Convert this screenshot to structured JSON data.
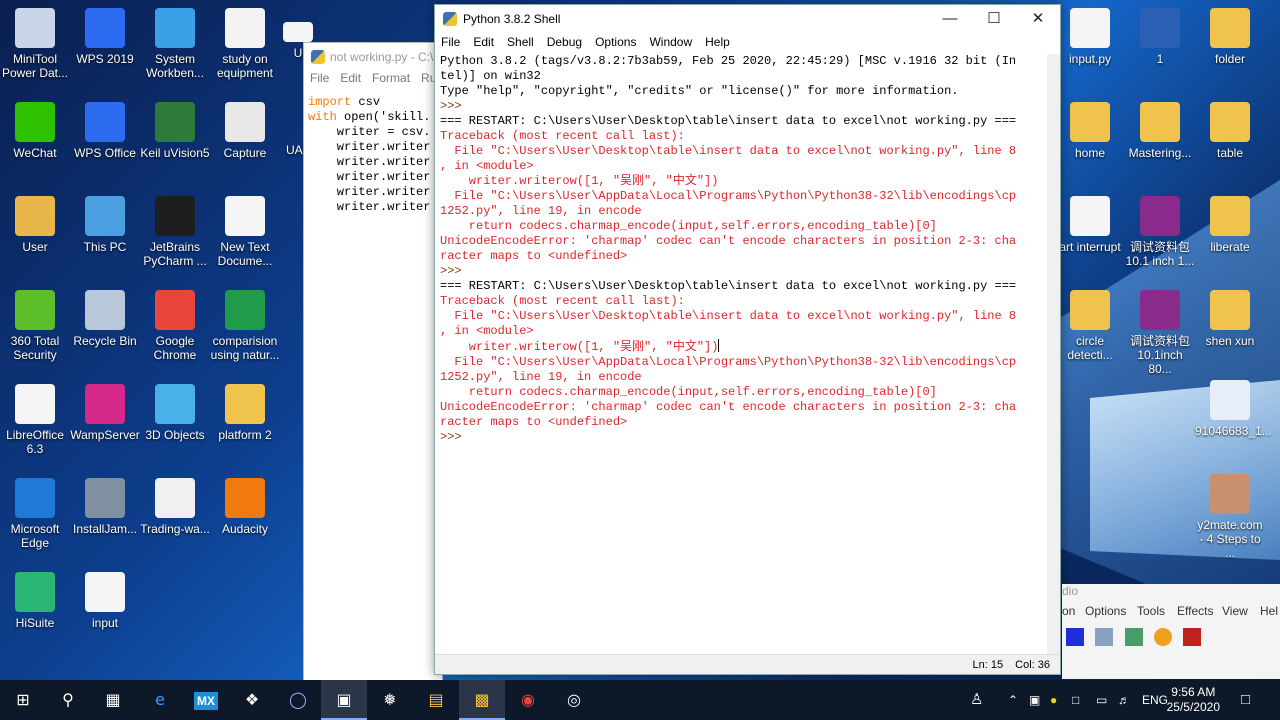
{
  "desktop_left": [
    {
      "label": "MiniTool Power Dat...",
      "icon": "minitool-icon",
      "color": "#c9d6e8"
    },
    {
      "label": "WPS 2019",
      "icon": "wps-icon",
      "color": "#2d6cf0"
    },
    {
      "label": "System Workben...",
      "icon": "bird-icon",
      "color": "#3aa0e8"
    },
    {
      "label": "study on equipment",
      "icon": "document-icon",
      "color": "#f3f3f3"
    },
    {
      "label": "WeChat",
      "icon": "wechat-icon",
      "color": "#2dc100"
    },
    {
      "label": "WPS Office",
      "icon": "wps-office-icon",
      "color": "#2d6cf0"
    },
    {
      "label": "Keil uVision5",
      "icon": "keil-icon",
      "color": "#2d7a3a"
    },
    {
      "label": "Capture",
      "icon": "capture-icon",
      "color": "#e8e8e8"
    },
    {
      "label": "User",
      "icon": "user-folder-icon",
      "color": "#e8b64a"
    },
    {
      "label": "This PC",
      "icon": "computer-icon",
      "color": "#4aa0e0"
    },
    {
      "label": "JetBrains PyCharm ...",
      "icon": "pycharm-icon",
      "color": "#1e1e1e"
    },
    {
      "label": "New Text Docume...",
      "icon": "text-file-icon",
      "color": "#f5f5f5"
    },
    {
      "label": "360 Total Security",
      "icon": "security-icon",
      "color": "#5cbf2a"
    },
    {
      "label": "Recycle Bin",
      "icon": "recycle-bin-icon",
      "color": "#b8c8d8"
    },
    {
      "label": "Google Chrome",
      "icon": "chrome-icon",
      "color": "#e8453c"
    },
    {
      "label": "comparision using natur...",
      "icon": "spreadsheet-icon",
      "color": "#1f9b4a"
    },
    {
      "label": "LibreOffice 6.3",
      "icon": "libreoffice-icon",
      "color": "#f5f5f5"
    },
    {
      "label": "WampServer",
      "icon": "wamp-icon",
      "color": "#d6278a"
    },
    {
      "label": "3D Objects",
      "icon": "3d-folder-icon",
      "color": "#4ab0e8"
    },
    {
      "label": "platform 2",
      "icon": "folder-icon",
      "color": "#f0c44c"
    },
    {
      "label": "Microsoft Edge",
      "icon": "edge-icon",
      "color": "#1e7ad6"
    },
    {
      "label": "InstallJam...",
      "icon": "installer-icon",
      "color": "#8090a0"
    },
    {
      "label": "Trading-wa...",
      "icon": "image-file-icon",
      "color": "#f0f0f0"
    },
    {
      "label": "Audacity",
      "icon": "audacity-icon",
      "color": "#f07a10"
    },
    {
      "label": "HiSuite",
      "icon": "hisuite-icon",
      "color": "#2bb673"
    },
    {
      "label": "input",
      "icon": "python-file-icon",
      "color": "#f5f5f5"
    }
  ],
  "desktop_right": [
    {
      "label": "input.py",
      "icon": "python-file-icon",
      "color": "#f5f5f5"
    },
    {
      "label": "1",
      "icon": "word-doc-icon",
      "color": "#2b5fb4"
    },
    {
      "label": "folder",
      "icon": "folder-icon",
      "color": "#f0c44c"
    },
    {
      "label": "home",
      "icon": "folder-icon",
      "color": "#f0c44c"
    },
    {
      "label": "Mastering...",
      "icon": "folder-icon",
      "color": "#f0c44c"
    },
    {
      "label": "table",
      "icon": "folder-icon",
      "color": "#f0c44c"
    },
    {
      "label": "art interrupt",
      "icon": "document-icon",
      "color": "#f5f5f5"
    },
    {
      "label": "调试资料包 10.1 inch 1...",
      "icon": "archive-icon",
      "color": "#8a2a8a"
    },
    {
      "label": "liberate",
      "icon": "folder-icon",
      "color": "#f0c44c"
    },
    {
      "label": "circle detecti...",
      "icon": "folder-icon",
      "color": "#f0c44c"
    },
    {
      "label": "调试资料包 10.1inch 80...",
      "icon": "archive-icon",
      "color": "#8a2a8a"
    },
    {
      "label": "shen xun",
      "icon": "folder-icon",
      "color": "#f0c44c"
    },
    {
      "label": "91046683_1...",
      "icon": "image-file-icon",
      "color": "#e8eef8"
    },
    {
      "label": "y2mate.com - 4 Steps to ...",
      "icon": "image-file-icon",
      "color": "#c89070"
    }
  ],
  "partial_icons": [
    {
      "label": "U",
      "icon": "partial-icon"
    },
    {
      "label": "UAF",
      "icon": "partial-icon"
    }
  ],
  "idle_window": {
    "title": "not working.py - C:\\",
    "menu": [
      "File",
      "Edit",
      "Format",
      "Ru"
    ],
    "code": [
      {
        "kw": "import",
        "rest": " csv"
      },
      {
        "kw": "with",
        "rest": " open('skill."
      },
      {
        "kw": "",
        "rest": "    writer = csv."
      },
      {
        "kw": "",
        "rest": "    writer.writer"
      },
      {
        "kw": "",
        "rest": "    writer.writer"
      },
      {
        "kw": "",
        "rest": "    writer.writer"
      },
      {
        "kw": "",
        "rest": "    writer.writer"
      },
      {
        "kw": "",
        "rest": "    writer.writer"
      }
    ]
  },
  "shell": {
    "title": "Python 3.8.2 Shell",
    "menu": [
      "File",
      "Edit",
      "Shell",
      "Debug",
      "Options",
      "Window",
      "Help"
    ],
    "lines": [
      {
        "t": "out",
        "s": "Python 3.8.2 (tags/v3.8.2:7b3ab59, Feb 25 2020, 22:45:29) [MSC v.1916 32 bit (In"
      },
      {
        "t": "out",
        "s": "tel)] on win32"
      },
      {
        "t": "out",
        "s": "Type \"help\", \"copyright\", \"credits\" or \"license()\" for more information."
      },
      {
        "t": "prompt",
        "s": ">>> "
      },
      {
        "t": "out",
        "s": "=== RESTART: C:\\Users\\User\\Desktop\\table\\insert data to excel\\not working.py ==="
      },
      {
        "t": "err",
        "s": "Traceback (most recent call last):"
      },
      {
        "t": "err",
        "s": "  File \"C:\\Users\\User\\Desktop\\table\\insert data to excel\\not working.py\", line 8"
      },
      {
        "t": "err",
        "s": ", in <module>"
      },
      {
        "t": "err",
        "s": "    writer.writerow([1, \"吴刚\", \"中文\"])"
      },
      {
        "t": "err",
        "s": "  File \"C:\\Users\\User\\AppData\\Local\\Programs\\Python\\Python38-32\\lib\\encodings\\cp"
      },
      {
        "t": "err",
        "s": "1252.py\", line 19, in encode"
      },
      {
        "t": "err",
        "s": "    return codecs.charmap_encode(input,self.errors,encoding_table)[0]"
      },
      {
        "t": "err",
        "s": "UnicodeEncodeError: 'charmap' codec can't encode characters in position 2-3: cha"
      },
      {
        "t": "err",
        "s": "racter maps to <undefined>"
      },
      {
        "t": "prompt",
        "s": ">>> "
      },
      {
        "t": "out",
        "s": "=== RESTART: C:\\Users\\User\\Desktop\\table\\insert data to excel\\not working.py ==="
      },
      {
        "t": "err",
        "s": "Traceback (most recent call last):"
      },
      {
        "t": "err",
        "s": "  File \"C:\\Users\\User\\Desktop\\table\\insert data to excel\\not working.py\", line 8"
      },
      {
        "t": "err",
        "s": ", in <module>"
      },
      {
        "t": "err",
        "s": "    writer.writerow([1, \"吴刚\", \"中文\"])"
      },
      {
        "t": "err",
        "s": "  File \"C:\\Users\\User\\AppData\\Local\\Programs\\Python\\Python38-32\\lib\\encodings\\cp"
      },
      {
        "t": "err",
        "s": "1252.py\", line 19, in encode"
      },
      {
        "t": "err",
        "s": "    return codecs.charmap_encode(input,self.errors,encoding_table)[0]"
      },
      {
        "t": "err",
        "s": "UnicodeEncodeError: 'charmap' codec can't encode characters in position 2-3: cha"
      },
      {
        "t": "err",
        "s": "racter maps to <undefined>"
      },
      {
        "t": "prompt",
        "s": ">>> "
      }
    ],
    "status": {
      "line": "Ln: 15",
      "col": "Col: 36"
    }
  },
  "background_window": {
    "title_fragment": "dio",
    "menu": [
      "on",
      "Options",
      "Tools",
      "Effects",
      "View",
      "Hel"
    ]
  },
  "taskbar": {
    "apps": [
      "start-icon",
      "search-icon",
      "task-view-icon",
      "edge-icon",
      "mx-icon",
      "dropbox-icon",
      "eclipse-icon",
      "window-icon",
      "capture-app-icon",
      "file-explorer-icon",
      "python-idle-icon",
      "chrome-icon",
      "obs-icon"
    ],
    "mx_label": "MX",
    "lang": "ENG",
    "time": "9:56 AM",
    "date": "25/5/2020"
  },
  "colors": {
    "error": "#e0262b",
    "prompt": "#8b3a00",
    "keyword": "#ff7700"
  }
}
